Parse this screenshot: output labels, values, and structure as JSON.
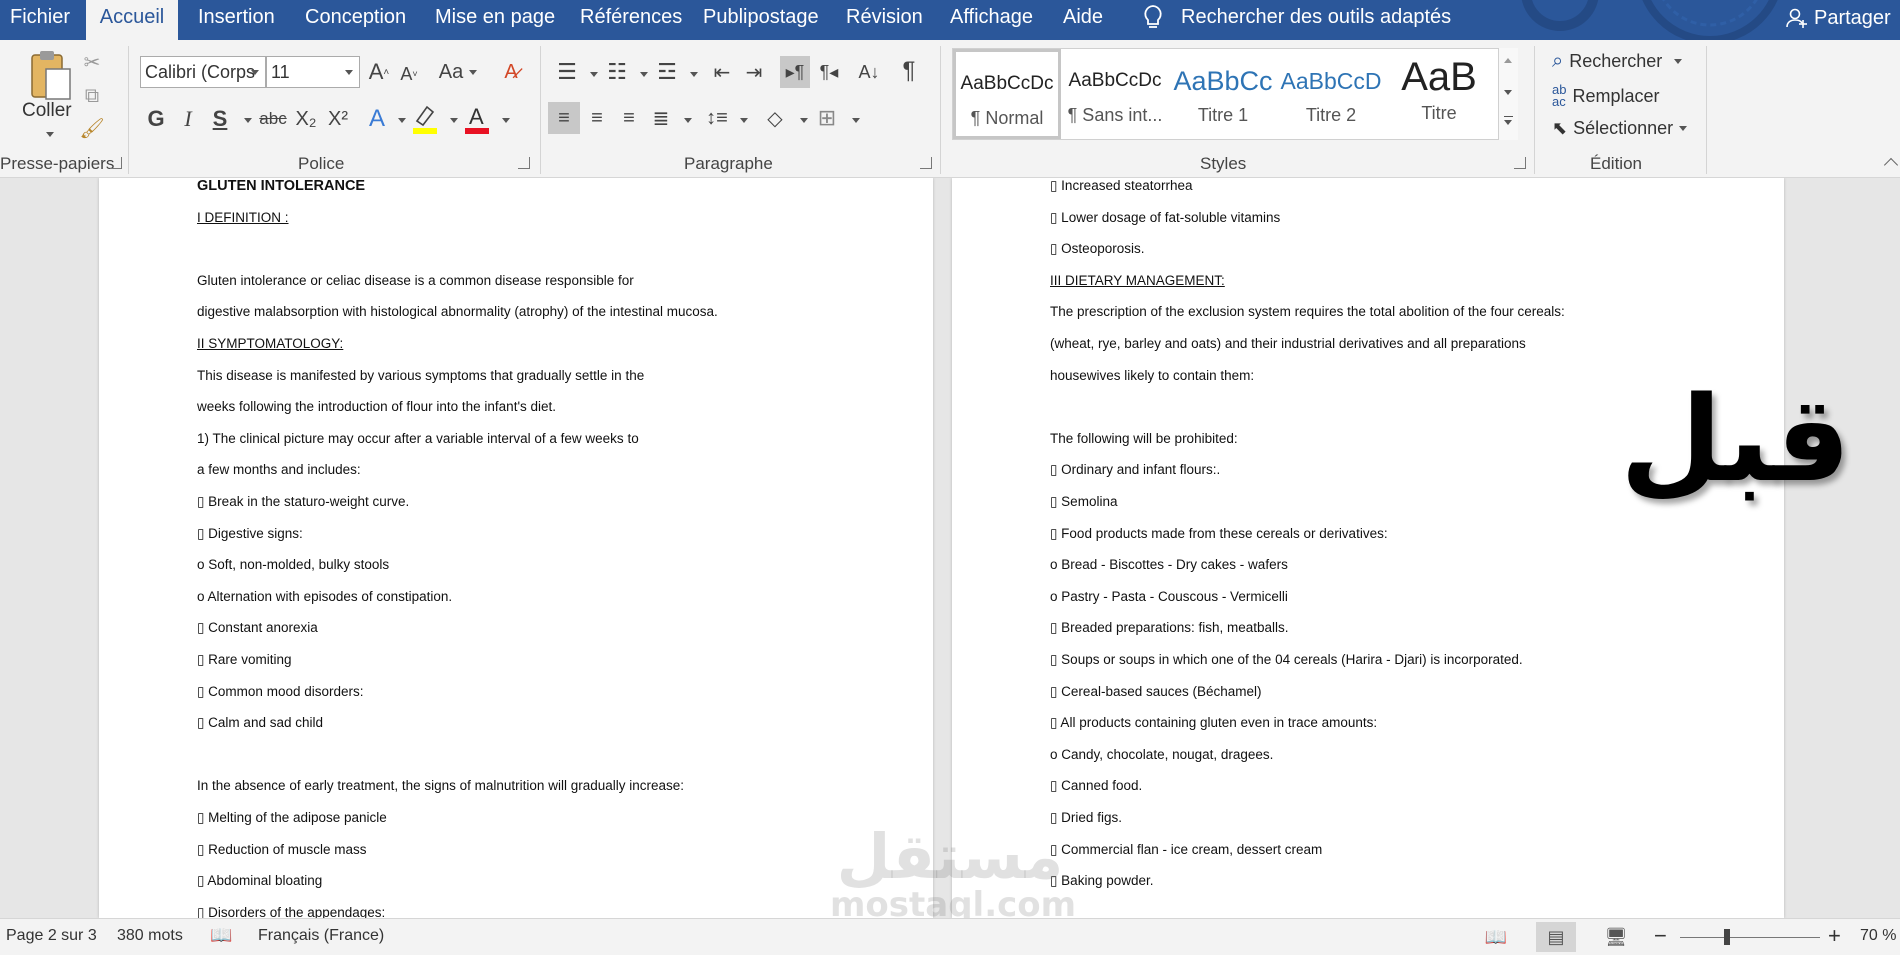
{
  "menu": {
    "tabs": [
      {
        "label": "Fichier",
        "active": false
      },
      {
        "label": "Accueil",
        "active": true
      },
      {
        "label": "Insertion",
        "active": false
      },
      {
        "label": "Conception",
        "active": false
      },
      {
        "label": "Mise en page",
        "active": false
      },
      {
        "label": "Références",
        "active": false
      },
      {
        "label": "Publipostage",
        "active": false
      },
      {
        "label": "Révision",
        "active": false
      },
      {
        "label": "Affichage",
        "active": false
      },
      {
        "label": "Aide",
        "active": false
      }
    ],
    "tell_me": "Rechercher des outils adaptés",
    "share": "Partager",
    "accent_color": "#2b579a"
  },
  "ribbon": {
    "clipboard": {
      "label": "Presse-papiers",
      "paste": "Coller"
    },
    "font": {
      "label": "Police",
      "font_name": "Calibri (Corps",
      "font_size": "11",
      "bold": "G",
      "italic": "I",
      "underline": "S",
      "strike": "abc",
      "sub": "X₂",
      "sup": "X²",
      "case": "Aa",
      "font_color": "#e81123",
      "highlight_color": "#ffff00"
    },
    "paragraph": {
      "label": "Paragraphe"
    },
    "styles": {
      "label": "Styles",
      "items": [
        {
          "preview": "AaBbCcDc",
          "name": "¶ Normal",
          "active": true
        },
        {
          "preview": "AaBbCcDc",
          "name": "¶ Sans int...",
          "active": false
        },
        {
          "preview": "AaBbCc",
          "name": "Titre 1",
          "active": false
        },
        {
          "preview": "AaBbCcD",
          "name": "Titre 2",
          "active": false
        },
        {
          "preview": "AaB",
          "name": "Titre",
          "active": false
        }
      ]
    },
    "editing": {
      "label": "Édition",
      "find": "Rechercher",
      "replace": "Remplacer",
      "select": "Sélectionner"
    }
  },
  "document": {
    "left_page": [
      {
        "text": "GLUTEN INTOLERANCE",
        "style": "bold"
      },
      {
        "text": "I DEFINITION :",
        "style": "underline"
      },
      {
        "text": "",
        "style": ""
      },
      {
        "text": "Gluten intolerance or celiac disease is a common disease responsible for",
        "style": ""
      },
      {
        "text": "digestive malabsorption with histological abnormality (atrophy) of the intestinal mucosa.",
        "style": ""
      },
      {
        "text": "II SYMPTOMATOLOGY:",
        "style": "underline"
      },
      {
        "text": "This disease is manifested by various symptoms that gradually settle in the",
        "style": ""
      },
      {
        "text": "weeks following the introduction of flour into the infant's diet.",
        "style": ""
      },
      {
        "text": "1) The clinical picture may occur after a variable interval of a few weeks to",
        "style": ""
      },
      {
        "text": "a few months and includes:",
        "style": ""
      },
      {
        "text": "▯ Break in the staturo-weight curve.",
        "style": ""
      },
      {
        "text": "▯ Digestive signs:",
        "style": ""
      },
      {
        "text": "o Soft, non-molded, bulky stools",
        "style": ""
      },
      {
        "text": "o Alternation with episodes of constipation.",
        "style": ""
      },
      {
        "text": "▯ Constant anorexia",
        "style": ""
      },
      {
        "text": "▯ Rare vomiting",
        "style": ""
      },
      {
        "text": "▯ Common mood disorders:",
        "style": ""
      },
      {
        "text": "▯ Calm and sad child",
        "style": ""
      },
      {
        "text": "",
        "style": ""
      },
      {
        "text": "In the absence of early treatment, the signs of malnutrition will gradually increase:",
        "style": ""
      },
      {
        "text": "▯ Melting of the adipose panicle",
        "style": ""
      },
      {
        "text": "▯ Reduction of muscle mass",
        "style": ""
      },
      {
        "text": "▯ Abdominal bloating",
        "style": ""
      },
      {
        "text": "▯ Disorders of the appendages:",
        "style": ""
      }
    ],
    "right_page": [
      {
        "text": "▯ Increased steatorrhea",
        "style": ""
      },
      {
        "text": "▯ Lower dosage of fat-soluble vitamins",
        "style": ""
      },
      {
        "text": "▯ Osteoporosis.",
        "style": ""
      },
      {
        "text": "III DIETARY MANAGEMENT:",
        "style": "underline"
      },
      {
        "text": "The prescription of the exclusion system requires the total abolition of the four cereals:",
        "style": ""
      },
      {
        "text": "(wheat, rye, barley and oats) and their industrial derivatives and all preparations",
        "style": ""
      },
      {
        "text": "housewives likely to contain them:",
        "style": ""
      },
      {
        "text": "",
        "style": ""
      },
      {
        "text": "The following will be prohibited:",
        "style": ""
      },
      {
        "text": "▯ Ordinary and infant flours:.",
        "style": ""
      },
      {
        "text": "▯ Semolina",
        "style": ""
      },
      {
        "text": "▯ Food products made from these cereals or derivatives:",
        "style": ""
      },
      {
        "text": "o Bread - Biscottes - Dry cakes - wafers",
        "style": ""
      },
      {
        "text": "o Pastry - Pasta - Couscous - Vermicelli",
        "style": ""
      },
      {
        "text": "▯ Breaded preparations: fish, meatballs.",
        "style": ""
      },
      {
        "text": "▯ Soups or soups in which one of the 04 cereals (Harira - Djari) is incorporated.",
        "style": ""
      },
      {
        "text": "▯ Cereal-based sauces (Béchamel)",
        "style": ""
      },
      {
        "text": "▯ All products containing gluten even in trace amounts:",
        "style": ""
      },
      {
        "text": "o Candy, chocolate, nougat, dragees.",
        "style": ""
      },
      {
        "text": "▯ Canned food.",
        "style": ""
      },
      {
        "text": "▯ Dried figs.",
        "style": ""
      },
      {
        "text": "▯ Commercial flan - ice cream, dessert cream",
        "style": ""
      },
      {
        "text": "▯ Baking powder.",
        "style": ""
      }
    ]
  },
  "overlay": {
    "arabic_label": "قبل",
    "watermark_ar": "مستقل",
    "watermark_en": "mostaql.com"
  },
  "status": {
    "page": "Page 2 sur 3",
    "words": "380 mots",
    "language": "Français (France)",
    "zoom": "70 %",
    "zoom_level_percent": 70
  }
}
